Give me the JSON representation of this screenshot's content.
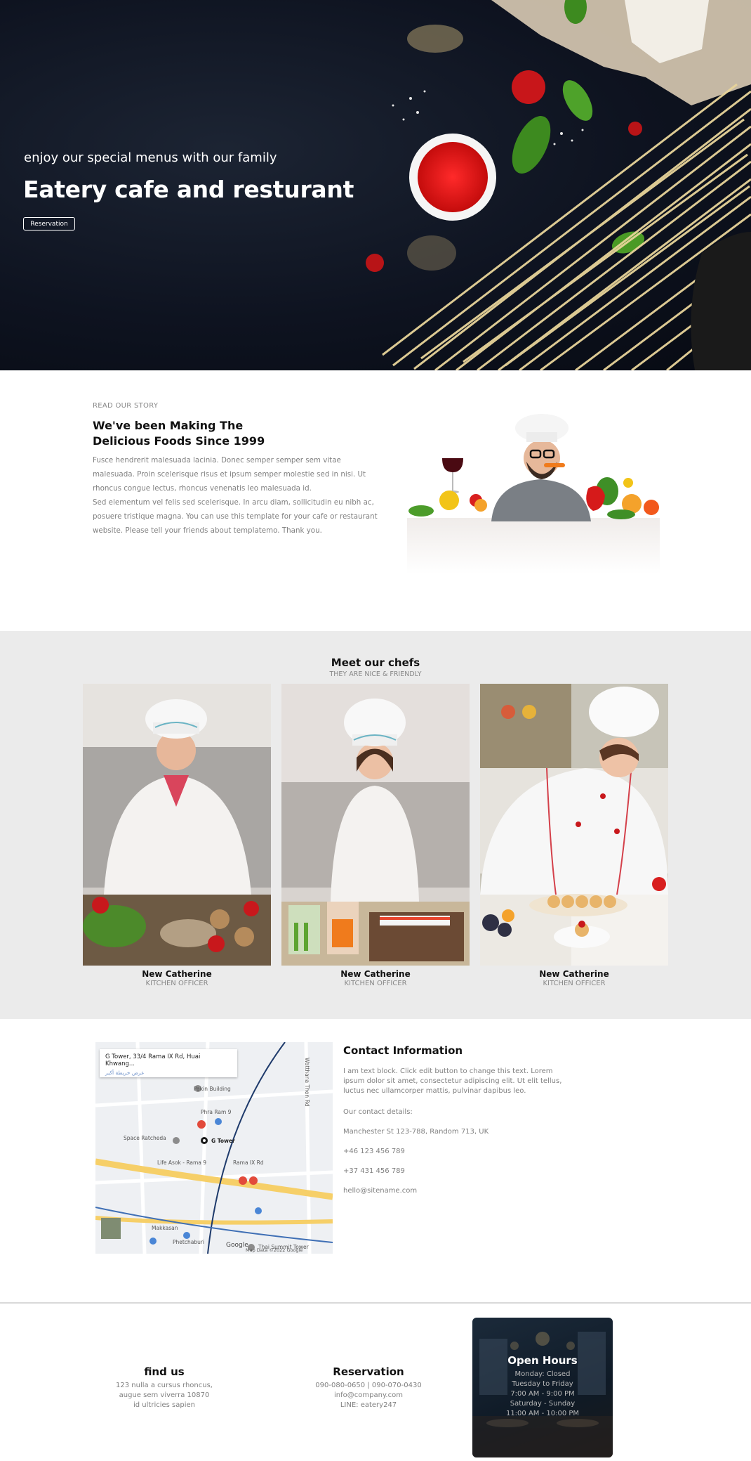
{
  "hero": {
    "tagline": "enjoy our special menus with our family",
    "title": "Eatery cafe and resturant",
    "button_label": "Reservation"
  },
  "story": {
    "eyebrow": "READ OUR STORY",
    "heading": "We've been Making The Delicious Foods Since 1999",
    "paragraph1": "Fusce hendrerit malesuada lacinia. Donec semper semper sem vitae malesuada. Proin scelerisque risus et ipsum semper molestie sed in nisi. Ut rhoncus congue lectus, rhoncus venenatis leo malesuada id.",
    "paragraph2": "Sed elementum vel felis sed scelerisque. In arcu diam, sollicitudin eu nibh ac, posuere tristique magna. You can use this template for your cafe or restaurant website. Please tell your friends about templatemo. Thank you."
  },
  "chefs": {
    "title": "Meet our chefs",
    "subtitle": "THEY ARE NICE & FRIENDLY",
    "items": [
      {
        "name": "New Catherine",
        "role": "KITCHEN OFFICER"
      },
      {
        "name": "New Catherine",
        "role": "KITCHEN OFFICER"
      },
      {
        "name": "New Catherine",
        "role": "KITCHEN OFFICER"
      }
    ]
  },
  "map": {
    "place": "G Tower, 33/4 Rama IX Rd, Huai Khwang...",
    "place_sub": "عرض خريطة أكبر",
    "labels": {
      "pakin": "Pakin Building",
      "phra_ram": "Phra Ram 9",
      "g_tower": "G Tower",
      "space": "Space Ratcheda",
      "life": "Life Asok - Rama 9",
      "rama9": "Rama IX Rd",
      "makkasan": "Makkasan",
      "phetchaburi": "Phetchaburi",
      "thai_summit": "Thai Summit Tower",
      "watthana": "Watthana Thon Rd",
      "google": "Google",
      "map_data": "Map Data ©2022 Google"
    }
  },
  "contact": {
    "title": "Contact Information",
    "description": "I am text block. Click edit button to change this text. Lorem ipsum dolor sit amet, consectetur adipiscing elit. Ut elit tellus, luctus nec ullamcorper mattis, pulvinar dapibus leo.",
    "details_label": "Our contact details:",
    "address": "Manchester St 123-788, Random 713, UK",
    "phone1": "+46 123 456 789",
    "phone2": "+37 431 456 789",
    "email": "hello@sitename.com"
  },
  "footer": {
    "find_us": {
      "title": "find us",
      "line1": "123 nulla a cursus rhoncus,",
      "line2": "augue sem viverra 10870",
      "line3": "id ultricies sapien"
    },
    "reservation": {
      "title": "Reservation",
      "line1": "090-080-0650 | 090-070-0430",
      "line2": "info@company.com",
      "line3": "LINE: eatery247"
    },
    "hours": {
      "title": "Open Hours",
      "line1": "Monday: Closed",
      "line2": "Tuesday to Friday",
      "line3": "7:00 AM - 9:00 PM",
      "line4": "Saturday - Sunday",
      "line5": "11:00 AM - 10:00 PM"
    }
  },
  "colors": {
    "hero_bg": "#0e1320",
    "chefs_bg": "#ebebeb",
    "muted_text": "#808080"
  }
}
